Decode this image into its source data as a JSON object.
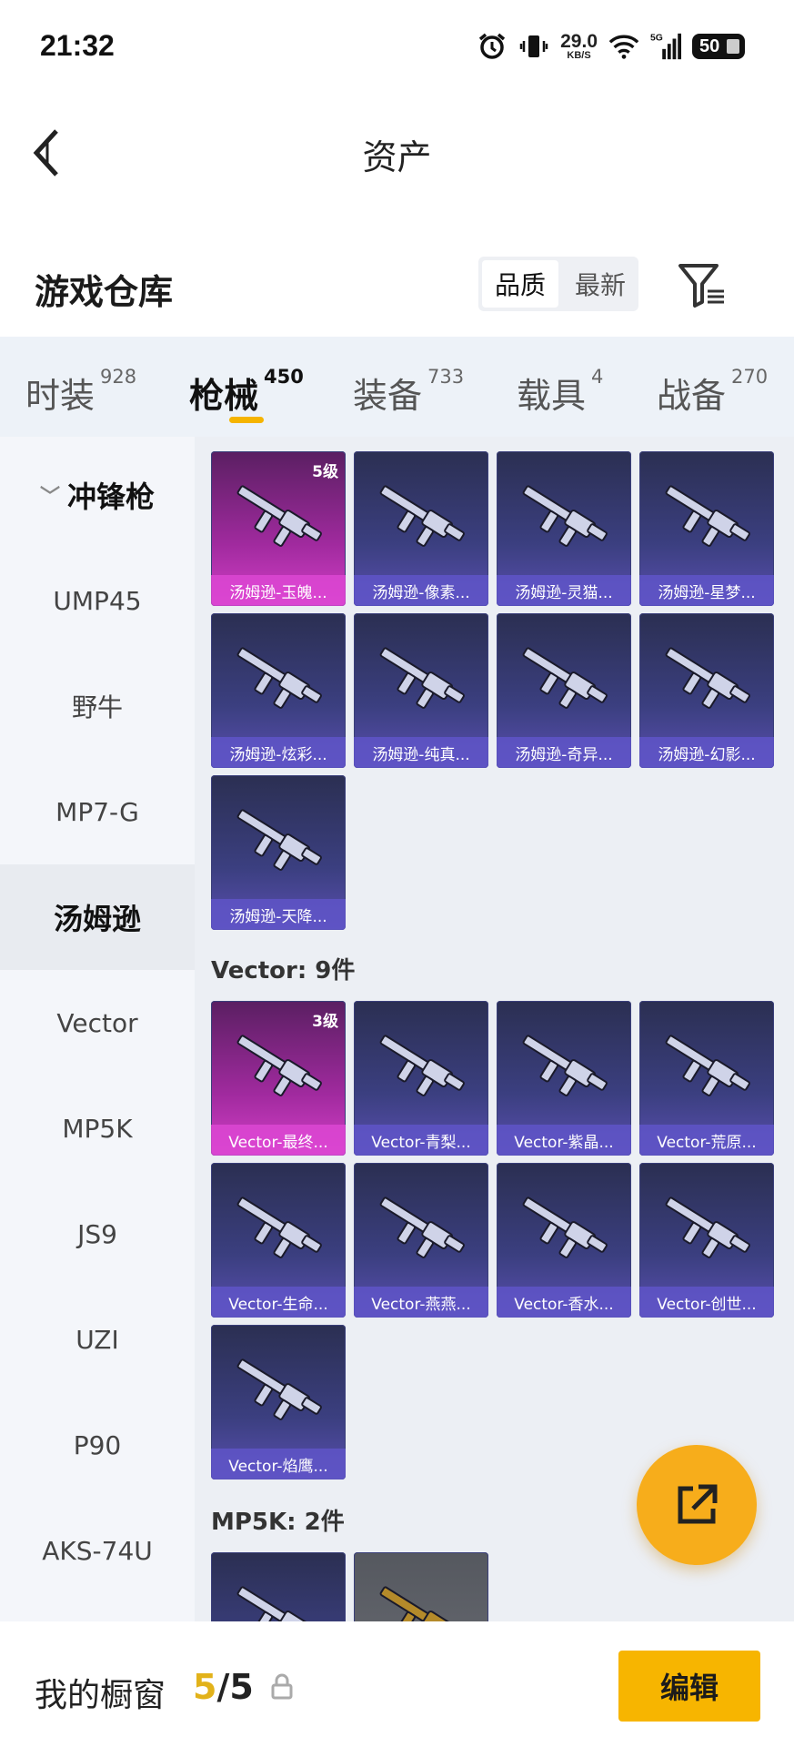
{
  "status_bar": {
    "time": "21:32",
    "net_speed": "29.0",
    "net_unit": "KB/S",
    "network": "5G",
    "battery": "50"
  },
  "header": {
    "title": "资产"
  },
  "warehouse": {
    "title": "游戏仓库",
    "sort_options": [
      "品质",
      "最新"
    ],
    "active_sort": "品质"
  },
  "tabs": [
    {
      "label": "时装",
      "count": "928"
    },
    {
      "label": "枪械",
      "count": "450",
      "active": true
    },
    {
      "label": "装备",
      "count": "733"
    },
    {
      "label": "载具",
      "count": "4"
    },
    {
      "label": "战备",
      "count": "270"
    }
  ],
  "sidebar": {
    "category": "冲锋枪",
    "items": [
      "UMP45",
      "野牛",
      "MP7-G",
      "汤姆逊",
      "Vector",
      "MP5K",
      "JS9",
      "UZI",
      "P90",
      "AKS-74U"
    ],
    "active": "汤姆逊"
  },
  "sections": [
    {
      "title": "",
      "items": [
        {
          "name": "汤姆逊-玉魄...",
          "level": "5级",
          "rarity": "purple"
        },
        {
          "name": "汤姆逊-像素...",
          "rarity": "blue"
        },
        {
          "name": "汤姆逊-灵猫...",
          "rarity": "blue"
        },
        {
          "name": "汤姆逊-星梦...",
          "rarity": "blue"
        },
        {
          "name": "汤姆逊-炫彩...",
          "rarity": "blue"
        },
        {
          "name": "汤姆逊-纯真...",
          "rarity": "blue"
        },
        {
          "name": "汤姆逊-奇异...",
          "rarity": "blue"
        },
        {
          "name": "汤姆逊-幻影...",
          "rarity": "blue"
        },
        {
          "name": "汤姆逊-天降...",
          "rarity": "blue"
        }
      ]
    },
    {
      "title": "Vector: 9件",
      "items": [
        {
          "name": "Vector-最终...",
          "level": "3级",
          "rarity": "purple"
        },
        {
          "name": "Vector-青梨...",
          "rarity": "blue"
        },
        {
          "name": "Vector-紫晶...",
          "rarity": "blue"
        },
        {
          "name": "Vector-荒原...",
          "rarity": "blue"
        },
        {
          "name": "Vector-生命...",
          "rarity": "blue"
        },
        {
          "name": "Vector-燕燕...",
          "rarity": "blue"
        },
        {
          "name": "Vector-香水...",
          "rarity": "blue"
        },
        {
          "name": "Vector-创世...",
          "rarity": "blue"
        },
        {
          "name": "Vector-焰鹰...",
          "rarity": "blue"
        }
      ]
    },
    {
      "title": "MP5K: 2件",
      "items": [
        {
          "name": "",
          "rarity": "blue"
        },
        {
          "name": "",
          "rarity": "gray"
        }
      ]
    }
  ],
  "showcase": {
    "label": "我的橱窗",
    "current": "5",
    "total": "5",
    "edit_label": "编辑"
  },
  "colors": {
    "accent": "#f7b500",
    "fab": "#f7ad1b",
    "tile_blue": "#3b3f80",
    "tile_purple": "#a02a9e"
  }
}
